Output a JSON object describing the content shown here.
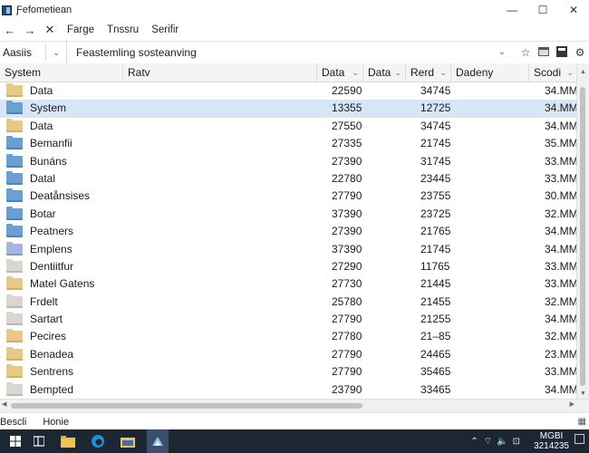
{
  "window": {
    "title": "Ƒefometiean",
    "minimize": "—",
    "maximize": "☐",
    "close": "✕"
  },
  "nav": {
    "back": "←",
    "forward": "→",
    "stop": "✕",
    "menu": [
      "Farge",
      "Tnssru",
      "Serifir"
    ]
  },
  "address": {
    "label": "Aasiis",
    "dropdown": "⌄",
    "value": "Feastemling  sosteanving",
    "value_dropdown": "⌄",
    "star": "☆"
  },
  "columns": [
    {
      "label": "System",
      "chevron": ""
    },
    {
      "label": "Ratv",
      "chevron": ""
    },
    {
      "label": "Data",
      "chevron": "⌄"
    },
    {
      "label": "Data",
      "chevron": "⌄"
    },
    {
      "label": "Rerd",
      "chevron": "⌄"
    },
    {
      "label": "Dadeny",
      "chevron": ""
    },
    {
      "label": "Scodi",
      "chevron": "⌄"
    }
  ],
  "rows": [
    {
      "name": "Data",
      "folder": "yellow",
      "val1": "22590",
      "val2": "34745",
      "size": "34.MM"
    },
    {
      "name": "System",
      "folder": "blue",
      "val1": "13355",
      "val2": "12725",
      "size": "34.MM",
      "selected": true
    },
    {
      "name": "Data",
      "folder": "yellow",
      "val1": "27550",
      "val2": "34745",
      "size": "34.MM"
    },
    {
      "name": "Bemanfii",
      "folder": "blue",
      "val1": "27335",
      "val2": "21745",
      "size": "35.MM"
    },
    {
      "name": "Bunáns",
      "folder": "blue",
      "val1": "27390",
      "val2": "31745",
      "size": "33.MM"
    },
    {
      "name": "Datal",
      "folder": "blue",
      "val1": "22780",
      "val2": "23445",
      "size": "33.MM"
    },
    {
      "name": "Deatånsises",
      "folder": "blue",
      "val1": "27790",
      "val2": "23755",
      "size": "30.MM"
    },
    {
      "name": "Botar",
      "folder": "blue",
      "val1": "37390",
      "val2": "23725",
      "size": "32.MM"
    },
    {
      "name": "Peatners",
      "folder": "blue",
      "val1": "27390",
      "val2": "21765",
      "size": "34.MM"
    },
    {
      "name": "Emplens",
      "folder": "lavender",
      "val1": "37390",
      "val2": "21745",
      "size": "34.MM"
    },
    {
      "name": "Dentiitfur",
      "folder": "gray",
      "val1": "27290",
      "val2": "11765",
      "size": "33.MM"
    },
    {
      "name": "Matel Gatens",
      "folder": "yellow",
      "val1": "27730",
      "val2": "21445",
      "size": "33.MM"
    },
    {
      "name": "Frdelt",
      "folder": "gray",
      "val1": "25780",
      "val2": "21455",
      "size": "32.MM"
    },
    {
      "name": "Sartart",
      "folder": "gray",
      "val1": "27790",
      "val2": "21255",
      "size": "34.MM"
    },
    {
      "name": "Pecires",
      "folder": "yellow",
      "val1": "27780",
      "val2": "21–85",
      "size": "32.MM"
    },
    {
      "name": "Benadea",
      "folder": "yellow",
      "val1": "27790",
      "val2": "24465",
      "size": "23.MM"
    },
    {
      "name": "Sentrens",
      "folder": "yellow",
      "val1": "27790",
      "val2": "35465",
      "size": "33.MM"
    },
    {
      "name": "Bempted",
      "folder": "gray",
      "val1": "23790",
      "val2": "33465",
      "size": "34.MM"
    }
  ],
  "status": {
    "left": "Bescli",
    "center": "Honie"
  },
  "taskbar": {
    "clock_line1": "MGBI",
    "clock_line2": "3214235"
  },
  "colors": {
    "selection": "#d7e6f7",
    "taskbar": "#1d2633",
    "folder_yellow": "#e8c886",
    "folder_blue": "#6b9fd3"
  }
}
